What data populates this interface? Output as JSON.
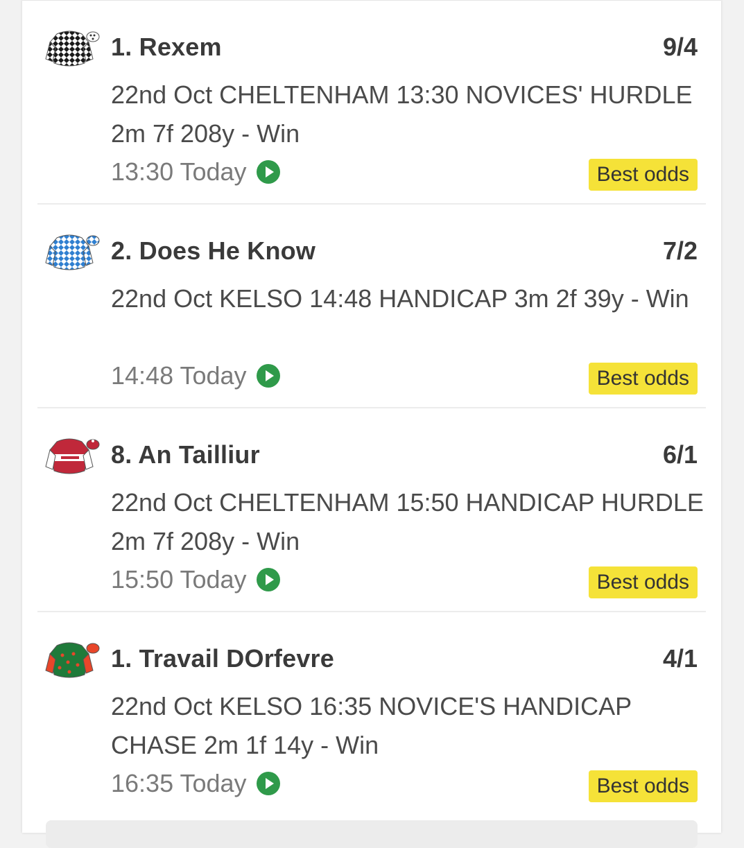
{
  "selections": [
    {
      "runner": "1. Rexem",
      "odds": "9/4",
      "race": "22nd Oct CHELTENHAM 13:30 NOVICES' HURDLE 2m 7f 208y - Win",
      "time": "13:30 Today",
      "badge": "Best odds",
      "silk_colors": {
        "body": "#1a1a1a",
        "pattern": "#ffffff",
        "cap": "#ffffff"
      }
    },
    {
      "runner": "2. Does He Know",
      "odds": "7/2",
      "race": "22nd Oct KELSO 14:48 HANDICAP 3m 2f 39y - Win",
      "time": "14:48 Today",
      "badge": "Best odds",
      "silk_colors": {
        "body": "#2f7fd0",
        "pattern": "#ffffff",
        "cap": "#2f7fd0"
      }
    },
    {
      "runner": "8. An Tailliur",
      "odds": "6/1",
      "race": "22nd Oct CHELTENHAM 15:50 HANDICAP HURDLE 2m 7f 208y - Win",
      "time": "15:50 Today",
      "badge": "Best odds",
      "silk_colors": {
        "body": "#c0283a",
        "pattern": "#ffffff",
        "cap": "#c0283a"
      }
    },
    {
      "runner": "1. Travail DOrfevre",
      "odds": "4/1",
      "race": "22nd Oct KELSO 16:35 NOVICE'S HANDICAP CHASE 2m 1f 14y - Win",
      "time": "16:35 Today",
      "badge": "Best odds",
      "silk_colors": {
        "body": "#1f7a3a",
        "pattern": "#e8462a",
        "cap": "#e8462a"
      }
    }
  ],
  "colors": {
    "badge_bg": "#f5e238",
    "play_icon": "#2f9a4a"
  }
}
